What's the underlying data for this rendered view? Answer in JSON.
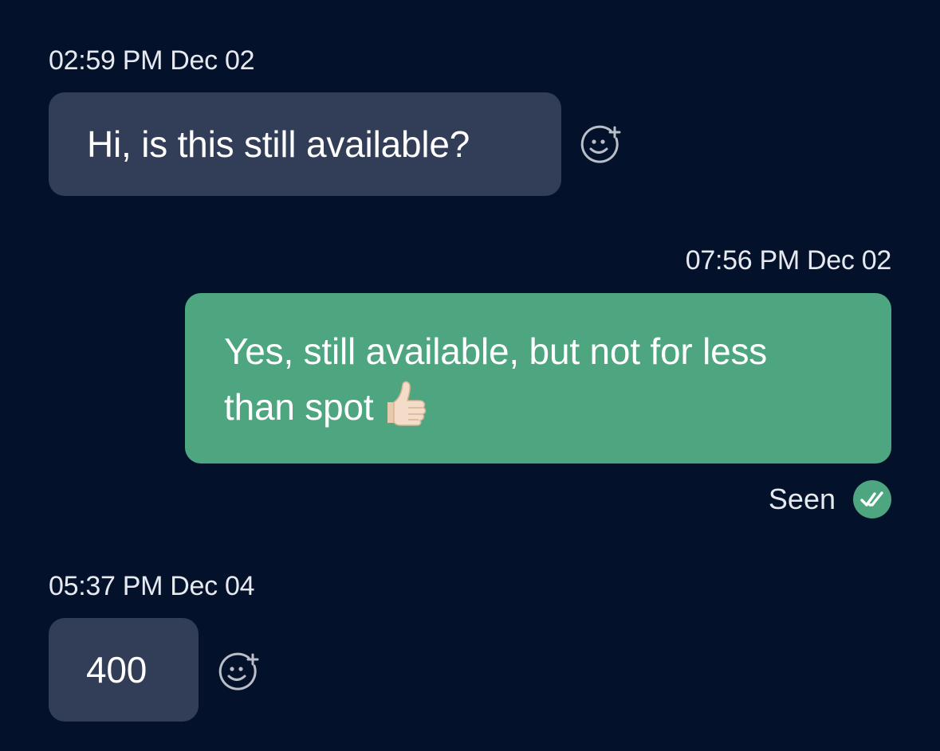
{
  "messages": [
    {
      "timestamp": "02:59 PM Dec 02",
      "text": "Hi, is this still available?",
      "direction": "incoming",
      "react_icon": "emoji-add-icon"
    },
    {
      "timestamp": "07:56 PM Dec 02",
      "text_line1": "Yes, still available, but not for less",
      "text_line2": "than spot",
      "emoji": "thumbs-up-icon",
      "direction": "outgoing",
      "status": "Seen",
      "status_icon": "double-check-icon"
    },
    {
      "timestamp": "05:37 PM Dec 04",
      "text": "400",
      "direction": "incoming",
      "react_icon": "emoji-add-icon"
    }
  ],
  "colors": {
    "background": "#03112a",
    "incoming_bubble": "#323d57",
    "outgoing_bubble": "#4ea680",
    "text": "#ffffff",
    "meta_text": "#e6e9ef",
    "seen_badge": "#4ea680"
  }
}
